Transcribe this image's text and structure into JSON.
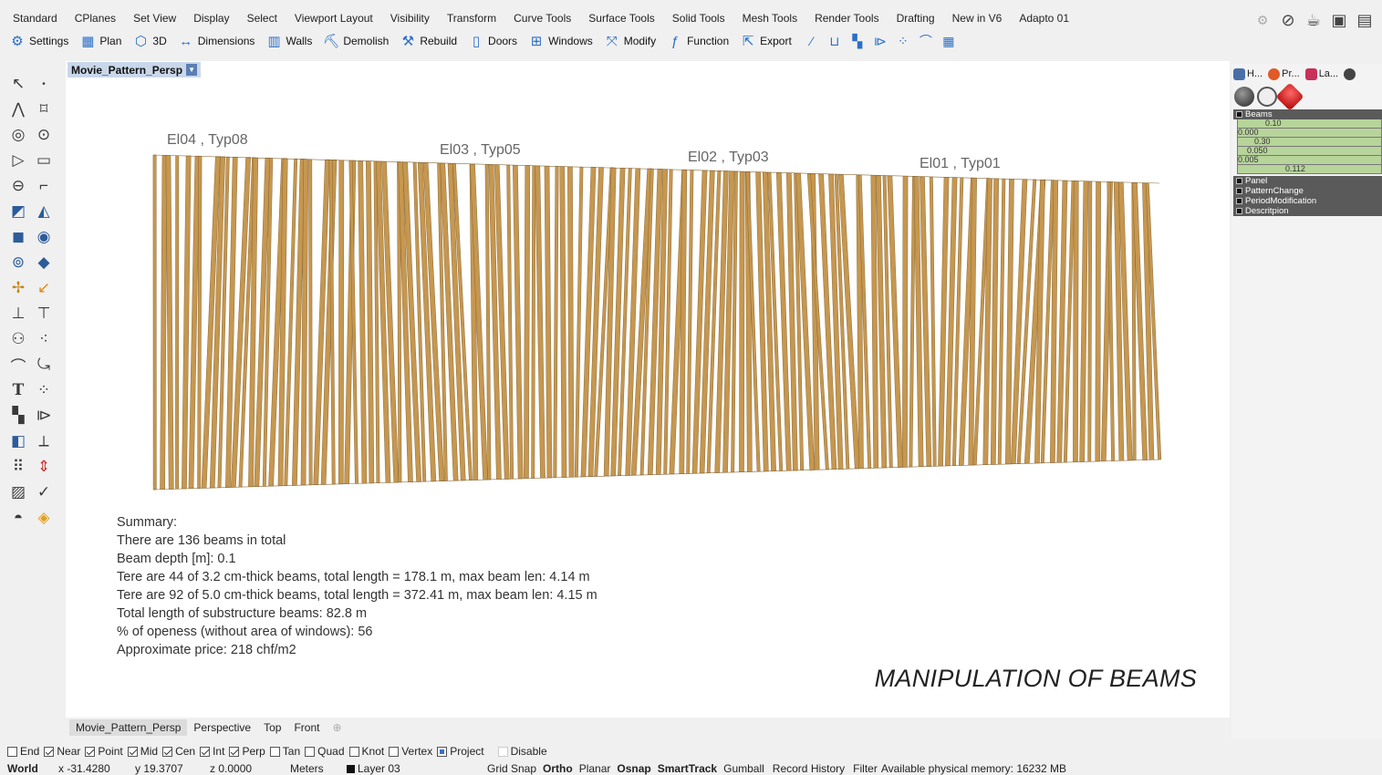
{
  "menu_tabs": [
    "Standard",
    "CPlanes",
    "Set View",
    "Display",
    "Select",
    "Viewport Layout",
    "Visibility",
    "Transform",
    "Curve Tools",
    "Surface Tools",
    "Solid Tools",
    "Mesh Tools",
    "Render Tools",
    "Drafting",
    "New in V6",
    "Adapto 01"
  ],
  "toolbar": {
    "buttons": [
      "Settings",
      "Plan",
      "3D",
      "Dimensions",
      "Walls",
      "Demolish",
      "Rebuild",
      "Doors",
      "Windows",
      "Modify",
      "Function",
      "Export"
    ],
    "icons": [
      "gear-icon",
      "grid-plan-icon",
      "cube-icon",
      "dimension-icon",
      "walls-icon",
      "demolish-icon",
      "rebuild-icon",
      "door-icon",
      "window-icon",
      "modify-icon",
      "function-icon",
      "export-icon"
    ]
  },
  "viewport": {
    "title": "Movie_Pattern_Persp",
    "elevation_labels": [
      "El04 , Typ08",
      "El03 , Typ05",
      "El02 , Typ03",
      "El01 , Typ01"
    ],
    "beam_color": "#c6974f",
    "beam_edge_color": "#7a5a2a",
    "beam_count": 136,
    "summary": [
      "Summary:",
      "There are  136 beams in total",
      "Beam depth [m]: 0.1",
      "Tere are 44 of 3.2 cm-thick beams, total length = 178.1 m, max beam len: 4.14  m",
      "Tere are 92 of 5.0 cm-thick beams, total length = 372.41 m, max beam len: 4.15  m",
      "Total length of substructure beams: 82.8 m",
      "% of openess (without area of windows): 56",
      "Approximate price: 218 chf/m2"
    ],
    "big_title": "MANIPULATION OF BEAMS"
  },
  "viewport_tabs": [
    "Movie_Pattern_Persp",
    "Perspective",
    "Top",
    "Front"
  ],
  "osnaps": [
    {
      "label": "End",
      "checked": false
    },
    {
      "label": "Near",
      "checked": true
    },
    {
      "label": "Point",
      "checked": true
    },
    {
      "label": "Mid",
      "checked": true
    },
    {
      "label": "Cen",
      "checked": true
    },
    {
      "label": "Int",
      "checked": true
    },
    {
      "label": "Perp",
      "checked": true
    },
    {
      "label": "Tan",
      "checked": false
    },
    {
      "label": "Quad",
      "checked": false
    },
    {
      "label": "Knot",
      "checked": false
    },
    {
      "label": "Vertex",
      "checked": false
    },
    {
      "label": "Project",
      "checked": "partial"
    },
    {
      "label": "Disable",
      "checked": false
    }
  ],
  "status": {
    "cplane": "World",
    "x": "x -31.4280",
    "y": "y 19.3707",
    "z": "z 0.0000",
    "units": "Meters",
    "layer": "Layer 03",
    "toggles": [
      "Grid Snap",
      "Ortho",
      "Planar",
      "Osnap",
      "SmartTrack",
      "Gumball",
      "Record History",
      "Filter"
    ],
    "memory": "Available physical memory: 16232 MB"
  },
  "right_panel": {
    "tabs": [
      "H...",
      "Pr...",
      "La..."
    ],
    "groups": {
      "beams": "Beams",
      "panel": "Panel",
      "pattern_change": "PatternChange",
      "period_modification": "PeriodModification",
      "description": "Descritpion"
    },
    "sliders": [
      "0.10",
      "0.000",
      "0.30",
      "0.050",
      "0.005",
      "0.112"
    ]
  }
}
